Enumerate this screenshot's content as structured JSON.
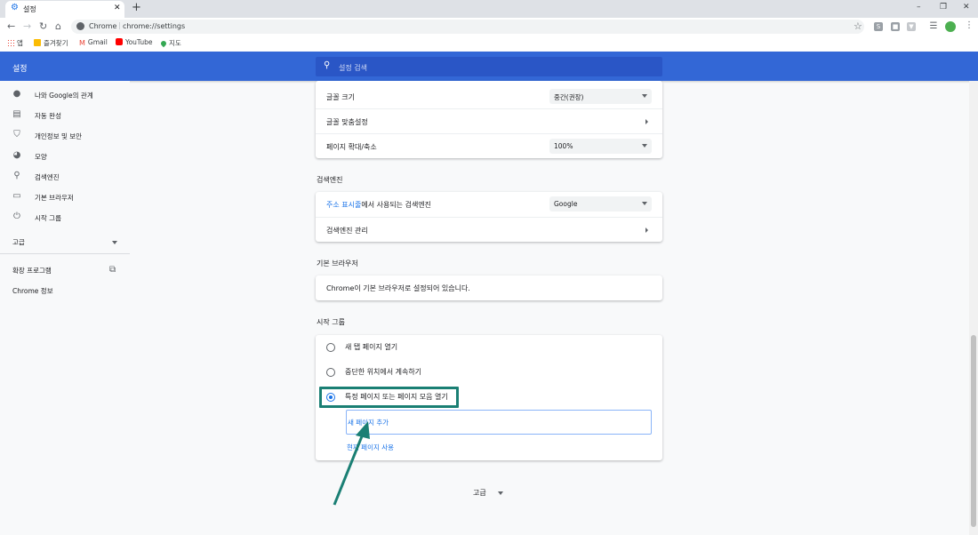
{
  "browser": {
    "tab_title": "설정",
    "tab_close": "✕",
    "new_tab": "+",
    "window_controls": [
      "–",
      "❐",
      "✕"
    ],
    "host": "Chrome",
    "url": "chrome://settings",
    "bookmarks": [
      "앱",
      "즐겨찾기",
      "Gmail",
      "YouTube",
      "지도"
    ]
  },
  "header": {
    "title": "설정",
    "search_placeholder": "설정 검색"
  },
  "sidebar": {
    "items": [
      {
        "label": "나와 Google의 관계",
        "icon": "person-icon"
      },
      {
        "label": "자동 완성",
        "icon": "clipboard-icon"
      },
      {
        "label": "개인정보 및 보안",
        "icon": "shield-icon"
      },
      {
        "label": "모양",
        "icon": "palette-icon"
      },
      {
        "label": "검색엔진",
        "icon": "search-icon"
      },
      {
        "label": "기본 브라우저",
        "icon": "browser-icon"
      },
      {
        "label": "시작 그룹",
        "icon": "power-icon"
      }
    ],
    "advanced": "고급",
    "extensions": "확장 프로그램",
    "about": "Chrome 정보"
  },
  "appearance": {
    "font_size_label": "글꼴 크기",
    "font_size_value": "중간(권장)",
    "custom_fonts_label": "글꼴 맞춤설정",
    "zoom_label": "페이지 확대/축소",
    "zoom_value": "100%"
  },
  "search_engine": {
    "section_title": "검색엔진",
    "address_bar_link": "주소 표시줄",
    "address_bar_rest": "에서 사용되는 검색엔진",
    "engine_value": "Google",
    "manage_label": "검색엔진 관리"
  },
  "default_browser": {
    "section_title": "기본 브라우저",
    "status": "Chrome이 기본 브라우저로 설정되어 있습니다."
  },
  "startup": {
    "section_title": "시작 그룹",
    "options": [
      "새 탭 페이지 열기",
      "중단한 위치에서 계속하기",
      "특정 페이지 또는 페이지 모음 열기"
    ],
    "selected_index": 2,
    "add_page": "새 페이지 추가",
    "use_current": "현재 페이지 사용"
  },
  "footer": {
    "advanced": "고급"
  },
  "colors": {
    "header_blue": "#3367d6",
    "search_blue": "#2a56c6",
    "accent": "#1a73e8",
    "annotation_teal": "#1a7f74"
  }
}
